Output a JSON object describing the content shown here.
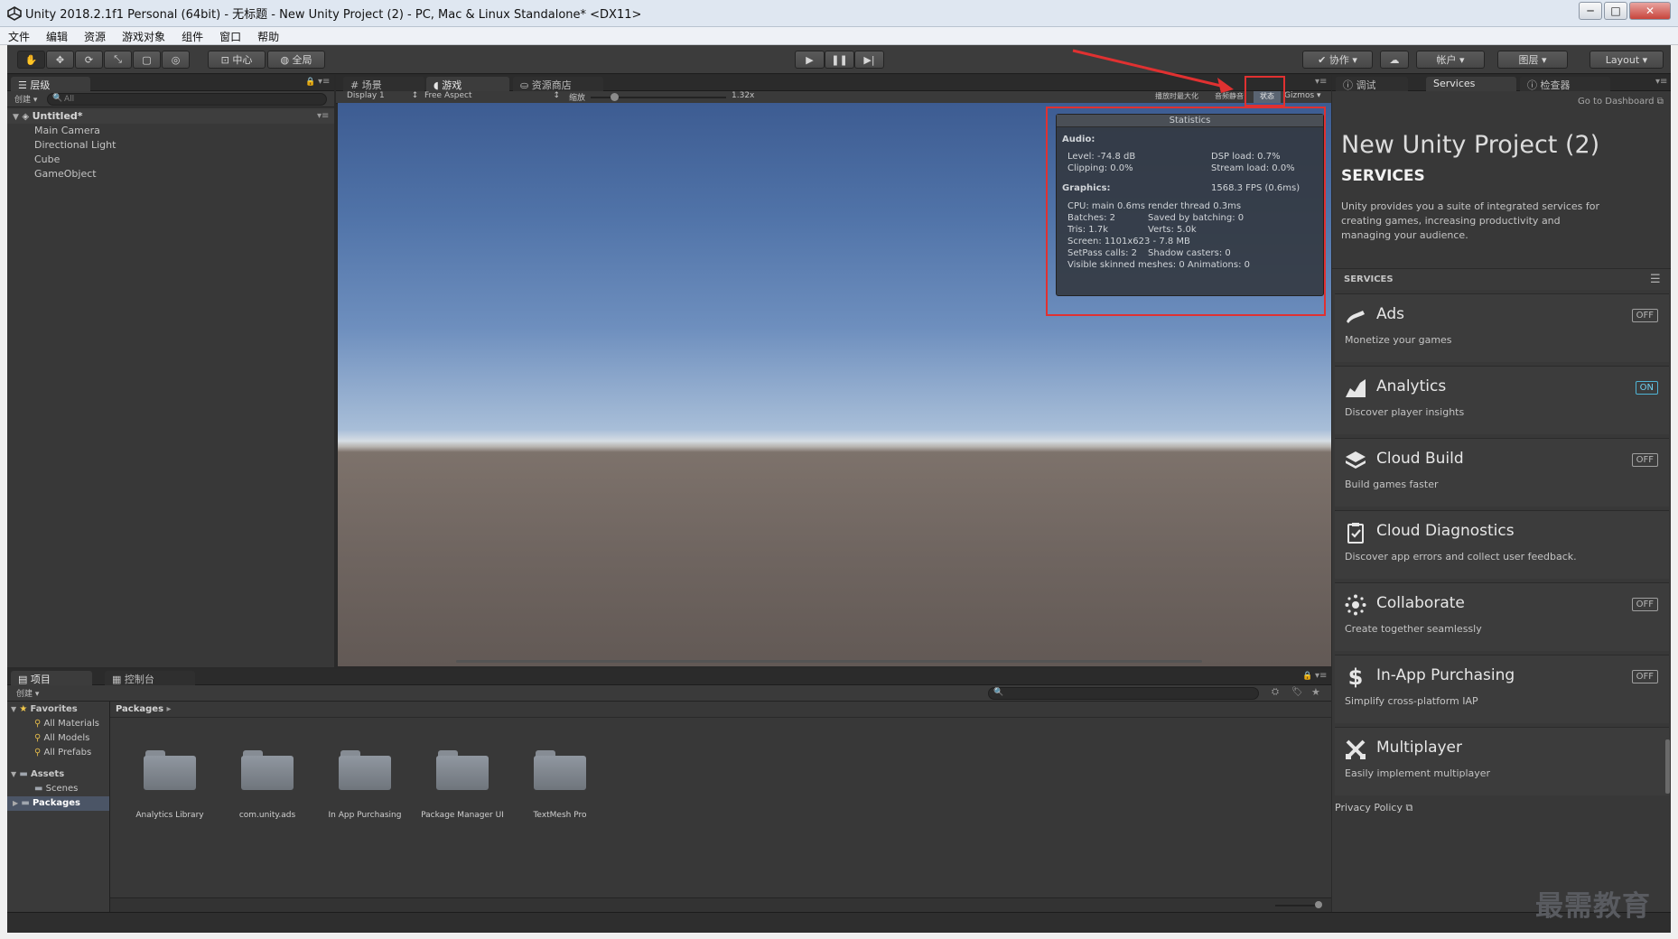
{
  "window": {
    "title": "Unity 2018.2.1f1 Personal (64bit) - 无标题 - New Unity Project (2) - PC, Mac & Linux Standalone* <DX11>",
    "min": "─",
    "max": "□",
    "close": "✕"
  },
  "menu": [
    "文件",
    "编辑",
    "资源",
    "游戏对象",
    "组件",
    "窗口",
    "帮助"
  ],
  "toolbar": {
    "pivot": "中心",
    "space": "全局",
    "collab": "协作",
    "account": "帐户",
    "layers": "图层",
    "layout": "Layout"
  },
  "hierarchy": {
    "tab": "层级",
    "create": "创建",
    "search_placeholder": "All",
    "scene": "Untitled*",
    "items": [
      "Main Camera",
      "Directional Light",
      "Cube",
      "GameObject"
    ]
  },
  "center": {
    "tabs": [
      "场景",
      "游戏",
      "资源商店"
    ],
    "display": "Display 1",
    "aspect": "Free Aspect",
    "scale_label": "缩放",
    "scale_value": "1.32x",
    "maximize": "播放时最大化",
    "mute": "音频静音",
    "stats_btn": "状态",
    "gizmos": "Gizmos"
  },
  "stats": {
    "header": "Statistics",
    "audio_label": "Audio:",
    "level": "Level: -74.8 dB",
    "clipping": "Clipping: 0.0%",
    "dsp": "DSP load: 0.7%",
    "stream": "Stream load: 0.0%",
    "graphics_label": "Graphics:",
    "fps": "1568.3 FPS (0.6ms)",
    "cpu": "CPU: main 0.6ms  render thread 0.3ms",
    "batches": "Batches: 2",
    "saved": "Saved by batching: 0",
    "tris": "Tris: 1.7k",
    "verts": "Verts: 5.0k",
    "screen": "Screen: 1101x623 - 7.8 MB",
    "setpass": "SetPass calls: 2",
    "shadow": "Shadow casters: 0",
    "skinned": "Visible skinned meshes: 0  Animations: 0"
  },
  "services_panel": {
    "tabs": [
      "调试",
      "Services",
      "检查器"
    ],
    "dashboard": "Go to Dashboard",
    "project_name": "New Unity Project (2)",
    "heading": "SERVICES",
    "intro": "Unity provides you a suite of integrated services for creating games, increasing productivity and managing your audience.",
    "section": "SERVICES",
    "items": [
      {
        "name": "Ads",
        "desc": "Monetize your games",
        "state": "OFF"
      },
      {
        "name": "Analytics",
        "desc": "Discover player insights",
        "state": "ON"
      },
      {
        "name": "Cloud Build",
        "desc": "Build games faster",
        "state": "OFF"
      },
      {
        "name": "Cloud Diagnostics",
        "desc": "Discover app errors and collect user feedback.",
        "state": ""
      },
      {
        "name": "Collaborate",
        "desc": "Create together seamlessly",
        "state": "OFF"
      },
      {
        "name": "In-App Purchasing",
        "desc": "Simplify cross-platform IAP",
        "state": "OFF"
      },
      {
        "name": "Multiplayer",
        "desc": "Easily implement multiplayer",
        "state": ""
      }
    ],
    "privacy": "Privacy Policy"
  },
  "project": {
    "tabs": [
      "项目",
      "控制台"
    ],
    "create": "创建",
    "favorites": "Favorites",
    "fav_items": [
      "All Materials",
      "All Models",
      "All Prefabs"
    ],
    "assets": "Assets",
    "scenes": "Scenes",
    "packages": "Packages",
    "breadcrumb": "Packages",
    "folders": [
      "Analytics Library",
      "com.unity.ads",
      "In App Purchasing",
      "Package Manager UI",
      "TextMesh Pro"
    ]
  },
  "watermark": "最需教育"
}
